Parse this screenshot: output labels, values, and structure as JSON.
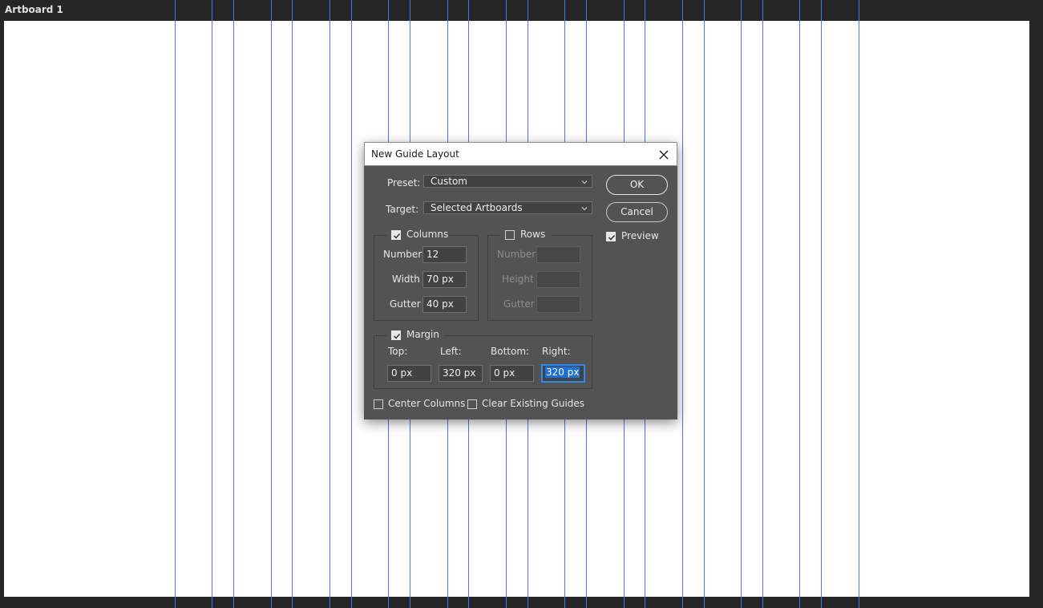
{
  "artboard": {
    "label": "Artboard 1"
  },
  "dialog": {
    "title": "New Guide Layout",
    "preset": {
      "label": "Preset:",
      "value": "Custom"
    },
    "target": {
      "label": "Target:",
      "value": "Selected Artboards"
    },
    "buttons": {
      "ok": "OK",
      "cancel": "Cancel"
    },
    "preview": {
      "label": "Preview",
      "checked": true
    },
    "columns": {
      "label": "Columns",
      "checked": true,
      "number_label": "Number",
      "number_value": "12",
      "width_label": "Width",
      "width_value": "70 px",
      "gutter_label": "Gutter",
      "gutter_value": "40 px"
    },
    "rows": {
      "label": "Rows",
      "checked": false,
      "number_label": "Number",
      "height_label": "Height",
      "gutter_label": "Gutter"
    },
    "margin": {
      "label": "Margin",
      "checked": true,
      "top_label": "Top:",
      "top_value": "0 px",
      "left_label": "Left:",
      "left_value": "320 px",
      "bottom_label": "Bottom:",
      "bottom_value": "0 px",
      "right_label": "Right:",
      "right_value": "320 px"
    },
    "center_columns": {
      "label": "Center Columns",
      "checked": false
    },
    "clear_guides": {
      "label": "Clear Existing Guides",
      "checked": false
    }
  },
  "colors": {
    "guide": "#4a73ff",
    "canvas_bg": "#262626",
    "dialog_bg": "#535353",
    "focus": "#2d8ceb"
  }
}
